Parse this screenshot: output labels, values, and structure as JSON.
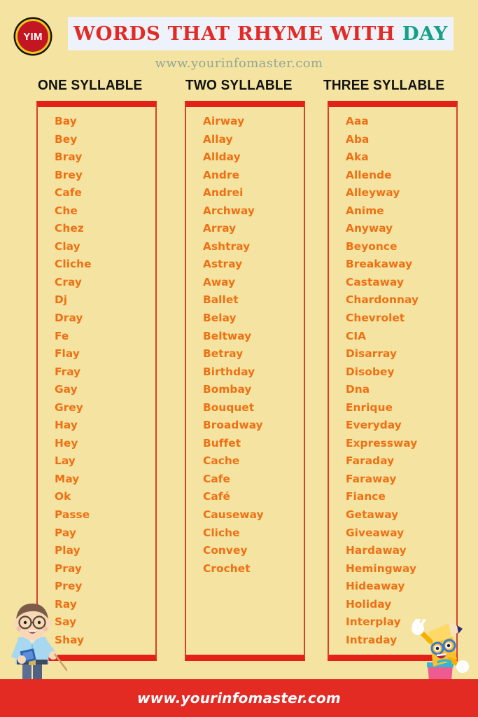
{
  "header": {
    "logo_text": "YIM",
    "title_main": "WORDS THAT RHYME WITH ",
    "title_highlight": "DAY",
    "subtitle": "www.yourinfomaster.com",
    "brand_red": "#e02b26",
    "brand_teal": "#16a085",
    "band_bg": "#eef3fb"
  },
  "columns": [
    {
      "heading": "ONE SYLLABLE",
      "words": [
        "Bay",
        "Bey",
        "Bray",
        "Brey",
        "Cafe",
        "Che",
        "Chez",
        "Clay",
        "Cliche",
        "Cray",
        "Dj",
        "Dray",
        "Fe",
        "Flay",
        "Fray",
        "Gay",
        "Grey",
        "Hay",
        "Hey",
        "Lay",
        "May",
        "Ok",
        "Passe",
        "Pay",
        "Play",
        "Pray",
        "Prey",
        "Ray",
        "Say",
        "Shay"
      ]
    },
    {
      "heading": "TWO SYLLABLE",
      "words": [
        "Airway",
        "Allay",
        "Allday",
        "Andre",
        "Andrei",
        "Archway",
        "Array",
        "Ashtray",
        "Astray",
        "Away",
        "Ballet",
        "Belay",
        "Beltway",
        "Betray",
        "Birthday",
        "Bombay",
        "Bouquet",
        "Broadway",
        "Buffet",
        "Cache",
        "Cafe",
        "Café",
        "Causeway",
        "Cliche",
        "Convey",
        "Crochet"
      ]
    },
    {
      "heading": "THREE SYLLABLE",
      "words": [
        "Aaa",
        "Aba",
        "Aka",
        "Allende",
        "Alleyway",
        "Anime",
        "Anyway",
        "Beyonce",
        "Breakaway",
        "Castaway",
        "Chardonnay",
        "Chevrolet",
        "CIA",
        "Disarray",
        "Disobey",
        "Dna",
        "Enrique",
        "Everyday",
        "Expressway",
        "Faraday",
        "Faraway",
        "Fiance",
        "Getaway",
        "Giveaway",
        "Hardaway",
        "Hemingway",
        "Hideaway",
        "Holiday",
        "Interplay",
        "Intraday"
      ]
    }
  ],
  "footer": {
    "url": "www.yourinfomaster.com",
    "bar_color": "#e32a23"
  },
  "theme": {
    "page_background": "#f4e3a1",
    "word_color": "#ef7014",
    "box_border": "#e32119",
    "heading_color": "#111111"
  },
  "illustrations": {
    "left": "teacher-character",
    "right": "pencil-mascot-character"
  }
}
